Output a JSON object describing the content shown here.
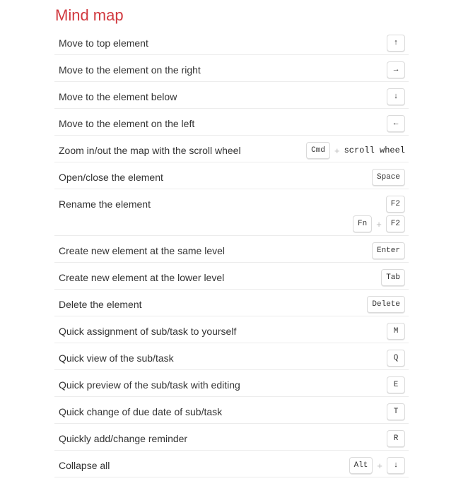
{
  "title": "Mind map",
  "accent_color": "#d1393f",
  "rows": [
    {
      "label": "Move to top element",
      "combos": [
        [
          {
            "type": "key",
            "text": "↑",
            "icon": "arrow-up-icon"
          }
        ]
      ]
    },
    {
      "label": "Move to the element on the right",
      "combos": [
        [
          {
            "type": "key",
            "text": "→",
            "icon": "arrow-right-icon"
          }
        ]
      ]
    },
    {
      "label": "Move to the element below",
      "combos": [
        [
          {
            "type": "key",
            "text": "↓",
            "icon": "arrow-down-icon"
          }
        ]
      ]
    },
    {
      "label": "Move to the element on the left",
      "combos": [
        [
          {
            "type": "key",
            "text": "←",
            "icon": "arrow-left-icon"
          }
        ]
      ]
    },
    {
      "label": "Zoom in/out the map with the scroll wheel",
      "combos": [
        [
          {
            "type": "key",
            "text": "Cmd"
          },
          {
            "type": "plus",
            "text": "+"
          },
          {
            "type": "text",
            "text": "scroll wheel"
          }
        ]
      ]
    },
    {
      "label": "Open/close the element",
      "combos": [
        [
          {
            "type": "key",
            "text": "Space"
          }
        ]
      ]
    },
    {
      "label": "Rename the element",
      "combos": [
        [
          {
            "type": "key",
            "text": "F2"
          }
        ],
        [
          {
            "type": "key",
            "text": "Fn"
          },
          {
            "type": "plus",
            "text": "+"
          },
          {
            "type": "key",
            "text": "F2"
          }
        ]
      ]
    },
    {
      "label": "Create new element at the same level",
      "combos": [
        [
          {
            "type": "key",
            "text": "Enter"
          }
        ]
      ]
    },
    {
      "label": "Create new element at the lower level",
      "combos": [
        [
          {
            "type": "key",
            "text": "Tab"
          }
        ]
      ]
    },
    {
      "label": "Delete the element",
      "combos": [
        [
          {
            "type": "key",
            "text": "Delete"
          }
        ]
      ]
    },
    {
      "label": "Quick assignment of sub/task to yourself",
      "combos": [
        [
          {
            "type": "key",
            "text": "M"
          }
        ]
      ]
    },
    {
      "label": "Quick view of the sub/task",
      "combos": [
        [
          {
            "type": "key",
            "text": "Q"
          }
        ]
      ]
    },
    {
      "label": "Quick preview of the sub/task with editing",
      "combos": [
        [
          {
            "type": "key",
            "text": "E"
          }
        ]
      ]
    },
    {
      "label": "Quick change of due date of sub/task",
      "combos": [
        [
          {
            "type": "key",
            "text": "T"
          }
        ]
      ]
    },
    {
      "label": "Quickly add/change reminder",
      "combos": [
        [
          {
            "type": "key",
            "text": "R"
          }
        ]
      ]
    },
    {
      "label": "Collapse all",
      "combos": [
        [
          {
            "type": "key",
            "text": "Alt"
          },
          {
            "type": "plus",
            "text": "+"
          },
          {
            "type": "key",
            "text": "↓",
            "icon": "arrow-down-icon"
          }
        ]
      ]
    }
  ]
}
